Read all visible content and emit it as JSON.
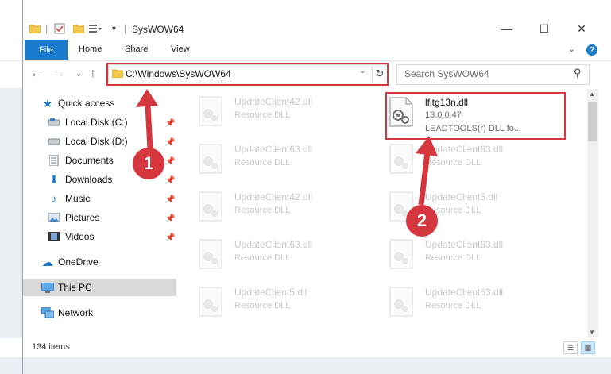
{
  "window": {
    "title": "SysWOW64",
    "controls": {
      "minimize": "—",
      "maximize": "☐",
      "close": "✕"
    }
  },
  "ribbon": {
    "file_tab": "File",
    "tabs": [
      "Home",
      "Share",
      "View"
    ]
  },
  "nav": {
    "address": "C:\\Windows\\SysWOW64",
    "search_placeholder": "Search SysWOW64"
  },
  "sidebar": {
    "items": [
      {
        "label": "Quick access",
        "icon": "star-icon"
      },
      {
        "label": "Local Disk (C:)",
        "icon": "drive-icon",
        "pinned": true
      },
      {
        "label": "Local Disk (D:)",
        "icon": "drive-icon",
        "pinned": true
      },
      {
        "label": "Documents",
        "icon": "documents-icon",
        "pinned": true
      },
      {
        "label": "Downloads",
        "icon": "download-icon",
        "pinned": true
      },
      {
        "label": "Music",
        "icon": "music-icon",
        "pinned": true
      },
      {
        "label": "Pictures",
        "icon": "pictures-icon",
        "pinned": true
      },
      {
        "label": "Videos",
        "icon": "videos-icon",
        "pinned": true
      },
      {
        "label": "OneDrive",
        "icon": "cloud-icon"
      },
      {
        "label": "This PC",
        "icon": "computer-icon",
        "selected": true
      },
      {
        "label": "Network",
        "icon": "network-icon"
      }
    ]
  },
  "files": {
    "highlighted": {
      "name": "lfitg13n.dll",
      "version": "13.0.0.47",
      "description": "LEADTOOLS(r) DLL fo..."
    },
    "background": [
      {
        "name": "UpdateClient42.dll",
        "type": "Resource DLL"
      },
      {
        "name": "UpdateClient63.dll",
        "type": "Resource DLL"
      },
      {
        "name": "UpdateClient63.dll",
        "type": "Resource DLL"
      },
      {
        "name": "UpdateClient42.dll",
        "type": "Resource DLL"
      },
      {
        "name": "UpdateClient5.dll",
        "type": "Resource DLL"
      },
      {
        "name": "UpdateClient63.dll",
        "type": "Resource DLL"
      },
      {
        "name": "UpdateClient63.dll",
        "type": "Resource DLL"
      },
      {
        "name": "UpdateClient5.dll",
        "type": "Resource DLL"
      },
      {
        "name": "UpdateClient63.dll",
        "type": "Resource DLL"
      }
    ]
  },
  "status": {
    "item_count": "134 items"
  },
  "annotations": {
    "step1": "1",
    "step2": "2",
    "color": "#d6363e"
  },
  "colors": {
    "accent": "#1979ca",
    "selection": "#d9d9d9",
    "highlight": "#d6363e"
  }
}
